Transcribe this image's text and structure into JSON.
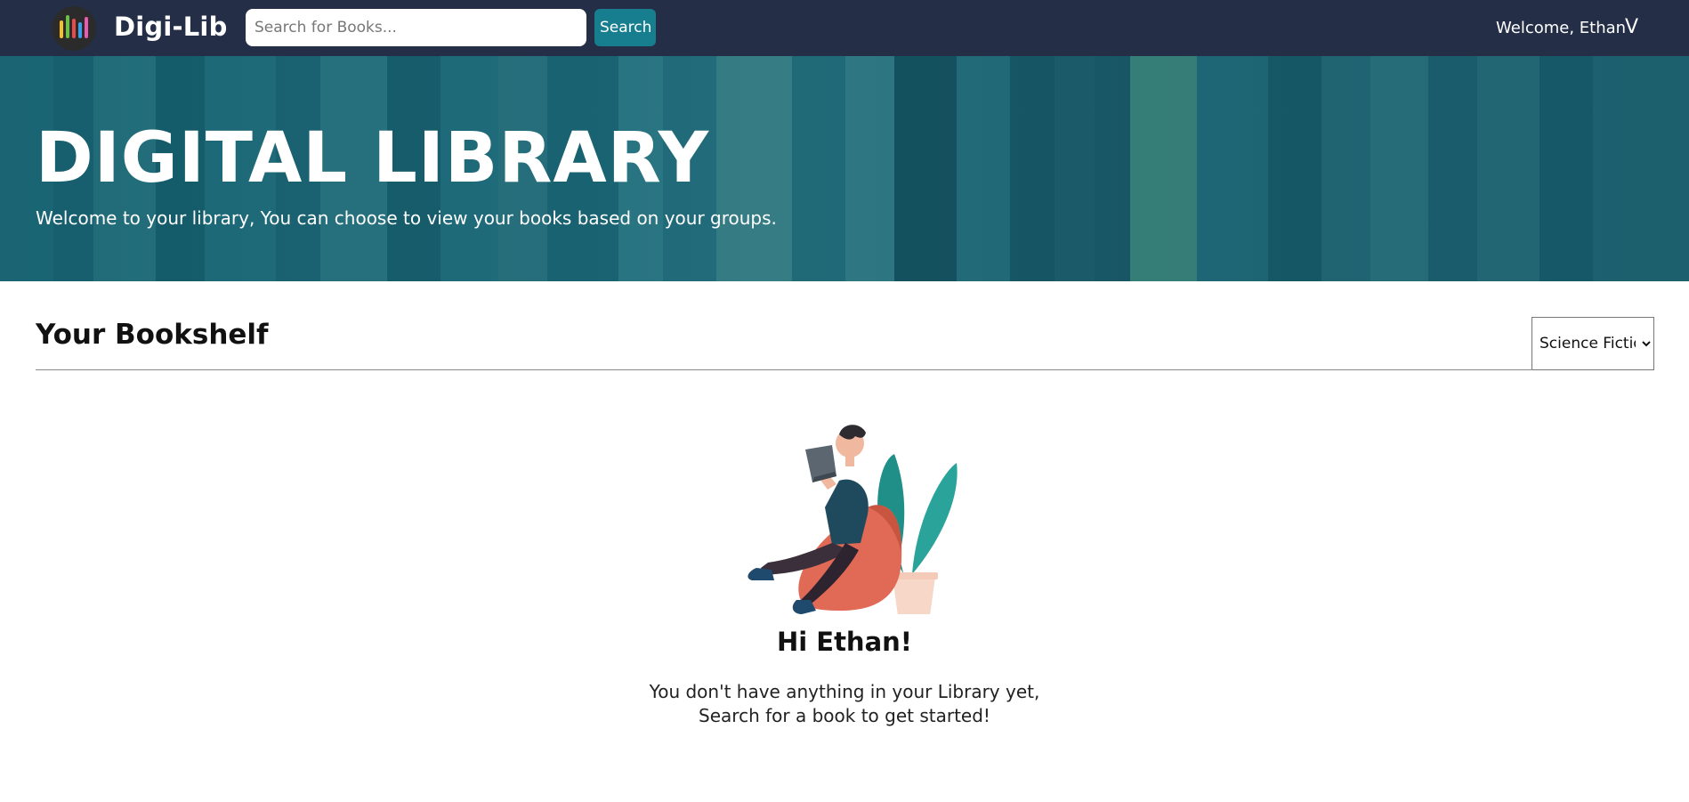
{
  "navbar": {
    "brand": "Digi-Lib",
    "search_placeholder": "Search for Books...",
    "search_button": "Search",
    "welcome": "Welcome, Ethan",
    "user_toggle": "V"
  },
  "hero": {
    "title": "DIGITAL LIBRARY",
    "subtitle": "Welcome to your library, You can choose to view your books based on your groups."
  },
  "bookshelf": {
    "title": "Your Bookshelf",
    "group_options": [
      "Science Fiction"
    ],
    "selected_group": "Science Fiction"
  },
  "empty_state": {
    "greeting": "Hi Ethan!",
    "line1": "You don't have anything in your Library yet,",
    "line2": "Search for a book to get started!"
  },
  "colors": {
    "navbar_bg": "#242f47",
    "accent": "#167e8f",
    "hero_bg": "#1f6e7c"
  }
}
